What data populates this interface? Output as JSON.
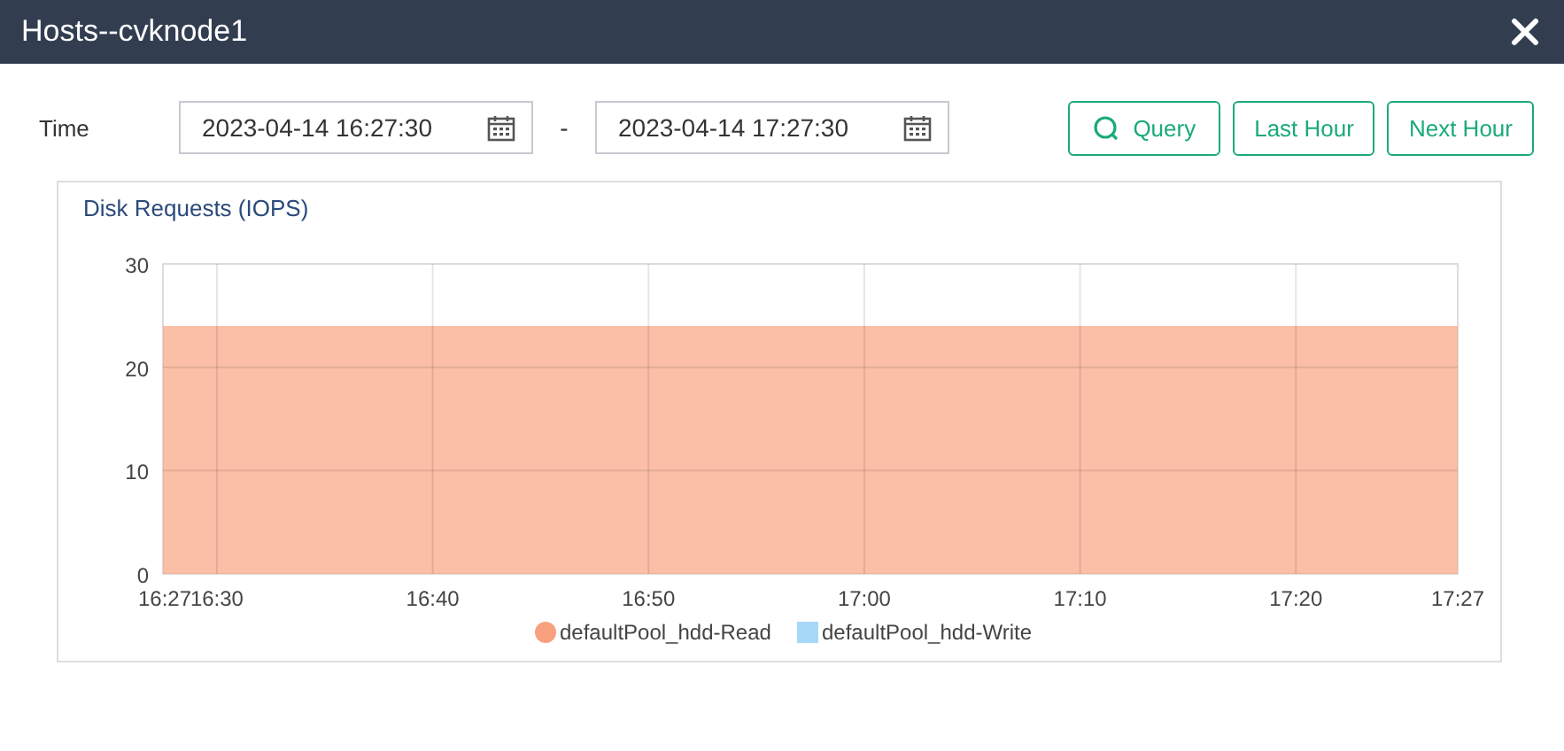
{
  "window": {
    "title": "Hosts--cvknode1"
  },
  "filter": {
    "label": "Time",
    "start": "2023-04-14 16:27:30",
    "separator": "-",
    "end": "2023-04-14 17:27:30"
  },
  "buttons": [
    {
      "label": "Query",
      "kind": "query"
    },
    {
      "label": "Last Hour",
      "kind": "plain"
    },
    {
      "label": "Next Hour",
      "kind": "plain"
    }
  ],
  "chart": {
    "chart_data": {
      "type": "area",
      "title": "Disk Requests (IOPS)",
      "x": [
        987.5,
        1047.5
      ],
      "series": [
        {
          "name": "defaultPool_hdd-Read",
          "color": "#f9a07e",
          "values": [
            24,
            24
          ]
        },
        {
          "name": "defaultPool_hdd-Write",
          "color": "#a7d8f7",
          "values": [
            null,
            null
          ]
        }
      ],
      "xlim": [
        987.5,
        1047.5
      ],
      "ylim": [
        0,
        30
      ],
      "xticks": [
        {
          "value": 987.5,
          "label": "16:27"
        },
        {
          "value": 990,
          "label": "16:30"
        },
        {
          "value": 1000,
          "label": "16:40"
        },
        {
          "value": 1010,
          "label": "16:50"
        },
        {
          "value": 1020,
          "label": "17:00"
        },
        {
          "value": 1030,
          "label": "17:10"
        },
        {
          "value": 1040,
          "label": "17:20"
        },
        {
          "value": 1047.5,
          "label": "17:27"
        }
      ],
      "yticks": [
        0,
        10,
        20,
        30
      ],
      "grid": true
    }
  }
}
